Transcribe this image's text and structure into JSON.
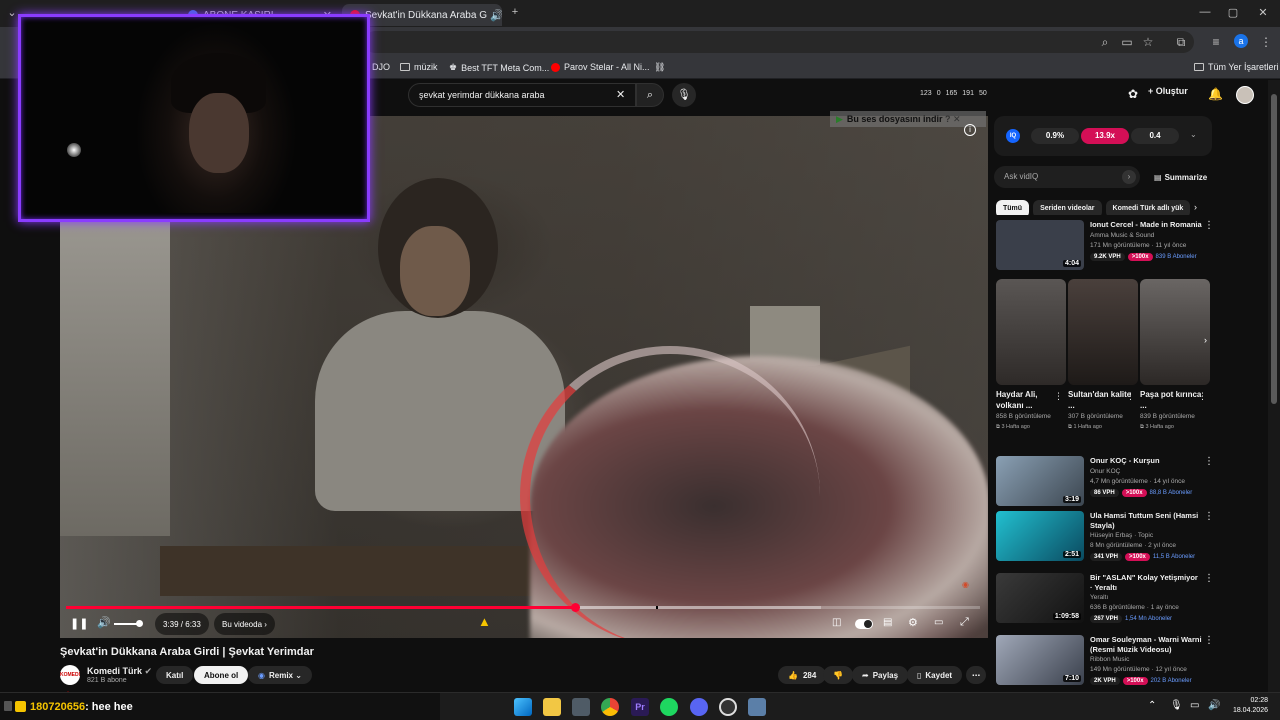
{
  "browser": {
    "tabs": [
      {
        "label": "ABONE KASIRI"
      },
      {
        "label": "Şevkat'in Dükkana Araba G"
      }
    ],
    "bookmarks": [
      {
        "label": "DJO"
      },
      {
        "label": "müzik"
      },
      {
        "label": "Best TFT Meta Com..."
      },
      {
        "label": "Parov Stelar - All Ni..."
      }
    ],
    "all_bookmarks": "Tüm Yer İşaretleri",
    "profile_letter": "a"
  },
  "youtube": {
    "search_query": "şevkat yerimdar dükkana araba",
    "stats": [
      "123",
      "0",
      "165",
      "191",
      "50"
    ],
    "create_label": "Oluştur"
  },
  "player": {
    "download_banner": "Bu ses dosyasını indir",
    "time": "3:39 / 6:33",
    "chapter": "Bu videoda",
    "progress_fraction": 0.557,
    "buffer_fraction": 0.826,
    "volume_fraction": 0.85
  },
  "video": {
    "title": "Şevkat'in Dükkana Araba Girdi | Şevkat Yerimdar",
    "channel": "Komedi Türk",
    "channel_logo": "KOMEDI TÜRK",
    "subscribers": "821 B abone",
    "join_label": "Katıl",
    "subscribe_label": "Abone ol",
    "remix_label": "Remix",
    "likes": "284",
    "share_label": "Paylaş",
    "save_label": "Kaydet"
  },
  "sidebar": {
    "vidiq": {
      "logo": "IQ",
      "a": "0.9%",
      "b": "13.9x",
      "c": "0.4"
    },
    "ask_placeholder": "Ask vidIQ",
    "summarize": "Summarize",
    "chips": [
      "Tümü",
      "Seriden videolar",
      "Komedi Türk adlı yük"
    ],
    "recs": [
      {
        "title": "Ionut Cercel - Made in Romania",
        "channel": "Amma Music & Sound",
        "views": "171 Mn görüntüleme · 11 yıl önce",
        "vph": "9.2K VPH",
        "x": ">100x",
        "subs": "839 B Aboneler",
        "duration": "4:04",
        "thumb_color": "#3a3f4a"
      },
      {
        "title": "Onur KOÇ - Kurşun",
        "channel": "Onur KOÇ",
        "views": "4,7 Mn görüntüleme · 14 yıl önce",
        "vph": "86 VPH",
        "x": ">100x",
        "subs": "88,8 B Aboneler",
        "duration": "3:19",
        "thumb_color": "#5c6a78"
      },
      {
        "title": "Ula Hamsi Tuttum Seni (Hamsi Stayla)",
        "channel": "Hüseyin Erbaş · Topic",
        "views": "8 Mn görüntüleme · 2 yıl önce",
        "vph": "341 VPH",
        "x": ">100x",
        "subs": "11,5 B Aboneler",
        "duration": "2:51",
        "thumb_color": "#1a8fa0"
      },
      {
        "title": "Bir \"ASLAN\" Kolay Yetişmiyor · Yeraltı",
        "channel": "Yeraltı",
        "views": "636 B görüntüleme · 1 ay önce",
        "vph": "267 VPH",
        "x": "",
        "subs": "1,54 Mn Aboneler",
        "duration": "1:09:58",
        "thumb_color": "#2a2a2a"
      },
      {
        "title": "Omar Souleyman - Warni Warni (Resmi Müzik Videosu)",
        "channel": "Ribbon Music",
        "views": "149 Mn görüntüleme · 12 yıl önce",
        "vph": "2K VPH",
        "x": ">100x",
        "subs": "202 B Aboneler",
        "duration": "7:10",
        "thumb_color": "#7a8090"
      }
    ],
    "shorts": [
      {
        "title": "Haydar Ali, volkanı ...",
        "views": "858 B görüntüleme",
        "ago": "3 Hafta ago",
        "color": "#4d4a48"
      },
      {
        "title": "Sultan'dan kalite ...",
        "views": "307 B görüntüleme",
        "ago": "1 Hafta ago",
        "color": "#3a3230"
      },
      {
        "title": "Paşa pot kırınca ...",
        "views": "839 B görüntüleme",
        "ago": "3 Hafta ago",
        "color": "#555"
      }
    ]
  },
  "taskbar": {
    "chat_user": "180720656",
    "chat_msg": ": hee hee",
    "time": "02:28",
    "date": "18.04.2026"
  }
}
